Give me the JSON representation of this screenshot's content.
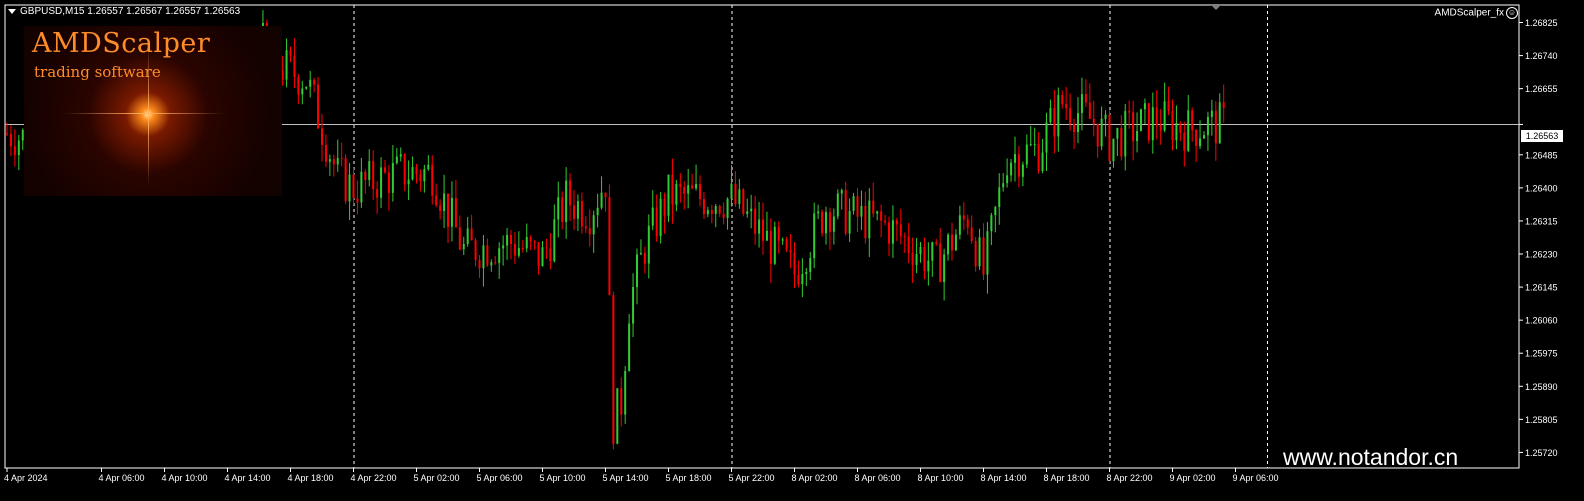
{
  "header": {
    "symbol_info": "GBPUSD,M15  1.26557 1.26567 1.26557 1.26563",
    "ea_name": "AMDScalper_fx"
  },
  "logo": {
    "brand": "AMDScalper",
    "tagline": "trading software"
  },
  "watermark": "www.notandor.cn",
  "current_price": "1.26563",
  "colors": {
    "background": "#000000",
    "bull": "#32cd32",
    "bear": "#ff0000",
    "grid": "#ffffff",
    "axis": "#ffffff",
    "price_line": "#c0c0c0"
  },
  "chart_data": {
    "type": "candlestick",
    "symbol": "GBPUSD",
    "timeframe": "M15",
    "ylim": [
      1.2568,
      1.2687
    ],
    "y_ticks": [
      "1.26825",
      "1.26740",
      "1.26655",
      "1.26563",
      "1.26485",
      "1.26400",
      "1.26315",
      "1.26230",
      "1.26145",
      "1.26060",
      "1.25975",
      "1.25890",
      "1.25805",
      "1.25720"
    ],
    "x_labels": [
      "4 Apr 2024",
      "4 Apr 06:00",
      "4 Apr 10:00",
      "4 Apr 14:00",
      "4 Apr 18:00",
      "4 Apr 22:00",
      "5 Apr 02:00",
      "5 Apr 06:00",
      "5 Apr 10:00",
      "5 Apr 14:00",
      "5 Apr 18:00",
      "5 Apr 22:00",
      "8 Apr 02:00",
      "8 Apr 06:00",
      "8 Apr 10:00",
      "8 Apr 14:00",
      "8 Apr 18:00",
      "8 Apr 22:00",
      "9 Apr 02:00",
      "9 Apr 06:00"
    ],
    "day_separators": [
      "4 Apr 22:00",
      "5 Apr 22:00",
      "8 Apr 22:00",
      "9 Apr 08:00"
    ],
    "path_points": [
      [
        "4 Apr 00:00",
        1.2654
      ],
      [
        "4 Apr 04:00",
        1.265
      ],
      [
        "4 Apr 08:00",
        1.2653
      ],
      [
        "4 Apr 11:00",
        1.266
      ],
      [
        "4 Apr 13:00",
        1.2655
      ],
      [
        "4 Apr 15:00",
        1.2668
      ],
      [
        "4 Apr 16:00",
        1.2678
      ],
      [
        "4 Apr 17:00",
        1.2672
      ],
      [
        "4 Apr 19:00",
        1.2668
      ],
      [
        "4 Apr 21:00",
        1.2643
      ],
      [
        "4 Apr 22:00",
        1.264
      ],
      [
        "5 Apr 01:00",
        1.2644
      ],
      [
        "5 Apr 03:00",
        1.2644
      ],
      [
        "5 Apr 05:00",
        1.2624
      ],
      [
        "5 Apr 08:00",
        1.2626
      ],
      [
        "5 Apr 10:00",
        1.2622
      ],
      [
        "5 Apr 11:30",
        1.2637
      ],
      [
        "5 Apr 13:00",
        1.2634
      ],
      [
        "5 Apr 14:00",
        1.2642
      ],
      [
        "5 Apr 14:15",
        1.2608
      ],
      [
        "5 Apr 14:30",
        1.258
      ],
      [
        "5 Apr 15:00",
        1.2585
      ],
      [
        "5 Apr 15:30",
        1.261
      ],
      [
        "5 Apr 16:30",
        1.2625
      ],
      [
        "5 Apr 18:00",
        1.2638
      ],
      [
        "5 Apr 22:00",
        1.2637
      ],
      [
        "8 Apr 01:00",
        1.2623
      ],
      [
        "8 Apr 02:00",
        1.2618
      ],
      [
        "8 Apr 04:00",
        1.2635
      ],
      [
        "8 Apr 08:00",
        1.263
      ],
      [
        "8 Apr 11:00",
        1.262
      ],
      [
        "8 Apr 13:00",
        1.2633
      ],
      [
        "8 Apr 14:00",
        1.2618
      ],
      [
        "8 Apr 15:30",
        1.2648
      ],
      [
        "8 Apr 17:30",
        1.265
      ],
      [
        "8 Apr 19:00",
        1.2662
      ],
      [
        "8 Apr 21:00",
        1.2657
      ],
      [
        "8 Apr 22:00",
        1.2652
      ],
      [
        "9 Apr 01:00",
        1.2658
      ],
      [
        "9 Apr 03:00",
        1.2655
      ],
      [
        "9 Apr 04:00",
        1.2656
      ],
      [
        "9 Apr 05:15",
        1.26563
      ]
    ]
  }
}
